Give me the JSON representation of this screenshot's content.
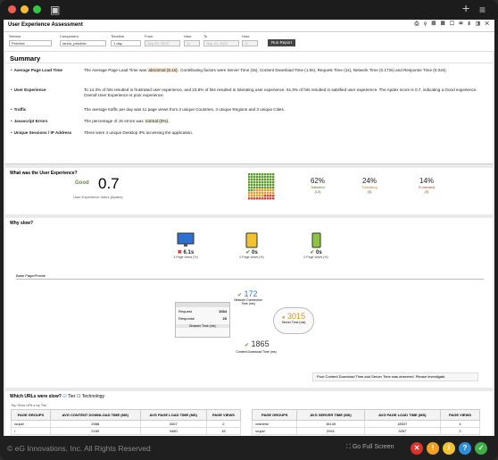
{
  "window": {
    "footer": "© eG Innovations, Inc. All Rights Reserved",
    "go_full_screen": "Go Full Screen"
  },
  "panel": {
    "title": "User Experience Assessment"
  },
  "filters": {
    "service": {
      "label": "Service",
      "value": "Petclinic"
    },
    "component": {
      "label": "Component",
      "value": "tandu_petclinic"
    },
    "timeline": {
      "label": "Timeline",
      "value": "1 day"
    },
    "from": {
      "label": "From",
      "value": "Sep 09, 2023"
    },
    "from_hour": {
      "label": "Hour",
      "value": "11"
    },
    "to": {
      "label": "To",
      "value": "Sep 10, 2023"
    },
    "to_hour": {
      "label": "Hour",
      "value": "11"
    },
    "run": "Run Report"
  },
  "summary": {
    "title": "Summary",
    "rows": [
      {
        "label": "Average Page Load Time",
        "text_a": "The Average Page Load Time was ",
        "hl": "abnormal (6.1s)",
        "text_b": ". Contributing factors were Server Time (3s), Content Download Time (1.9s), Request Time (1s), Network Time (0.172s) and Response Time (0.02s)."
      },
      {
        "label": "User Experience",
        "text": "To 14.3% of hits resulted in frustrated user experience, and 23.8% of hits resulted in tolerating user experience. 61.9% of hits resulted in satisfied user experience. The Apdex score is 0.7, indicating a Good experience. Overall User Experience is poor experience."
      },
      {
        "label": "Traffic",
        "text": "The average traffic per day was 11 page views from 3 unique Countries, 3 unique Regions and 3 unique Cities."
      },
      {
        "label": "Javascript Errors",
        "text_a": "The percentage of JS errors was ",
        "hl": "normal (0%)",
        "text_b": "."
      },
      {
        "label": "Unique Sessions / IP Address",
        "text": "There were 4 unique Desktop IPs accessing the application."
      }
    ]
  },
  "ux": {
    "title": "What was the User Experience?",
    "rating": "Good",
    "apdex": "0.7",
    "apdex_label": "User Experience Index (Apdex)",
    "satisfied": {
      "pct": "62%",
      "label": "Satisfied",
      "count": "(13)"
    },
    "tolerating": {
      "pct": "24%",
      "label": "Tolerating",
      "count": "(5)"
    },
    "frustrated": {
      "pct": "14%",
      "label": "Frustrated",
      "count": "(3)"
    }
  },
  "why": {
    "title": "Why slow?",
    "devices": [
      {
        "time": "6.1s",
        "views": "3 Page views (%)"
      },
      {
        "time": "0s",
        "views": "0 Page views (%)"
      },
      {
        "time": "0s",
        "views": "0 Page views (%)"
      }
    ],
    "tab": "Base Page/iFrame",
    "network": {
      "value": "172",
      "label": "Network Connection Time (ms)"
    },
    "server": {
      "value": "3015",
      "label": "Server Time (ms)"
    },
    "content": {
      "value": "1865",
      "label": "Content Download Time (ms)"
    },
    "request": {
      "label": "Request",
      "value": "1034"
    },
    "response": {
      "label": "Response",
      "value": "20"
    },
    "browser": "Browser Time (ms)",
    "note": "Poor Content Download Time and Server Time was observed. Please Investigate."
  },
  "urls": {
    "title": "Which URLs were slow?",
    "tier": "Tier",
    "technology": "Technology",
    "subtitle": "Top Slow URLs by Tier",
    "left_headers": [
      "PAGE GROUPS",
      "AVG CONTENT DOWNLOAD TIME (MS)",
      "AVG PAGE LOAD TIME (MS)",
      "PAGE VIEWS"
    ],
    "left_rows": [
      [
        "/oups/",
        "2588",
        "3267",
        "2"
      ],
      [
        "/",
        "2169",
        "3480",
        "15"
      ]
    ],
    "right_headers": [
      "PAGE GROUPS",
      "AVG SERVER TIME (MS)",
      "AVG PAGE LOAD TIME (MS)",
      "PAGE VIEWS"
    ],
    "right_rows": [
      [
        "/owners/",
        "15140",
        "18537",
        "4"
      ],
      [
        "/oups/",
        "2941",
        "3267",
        "2"
      ]
    ]
  }
}
